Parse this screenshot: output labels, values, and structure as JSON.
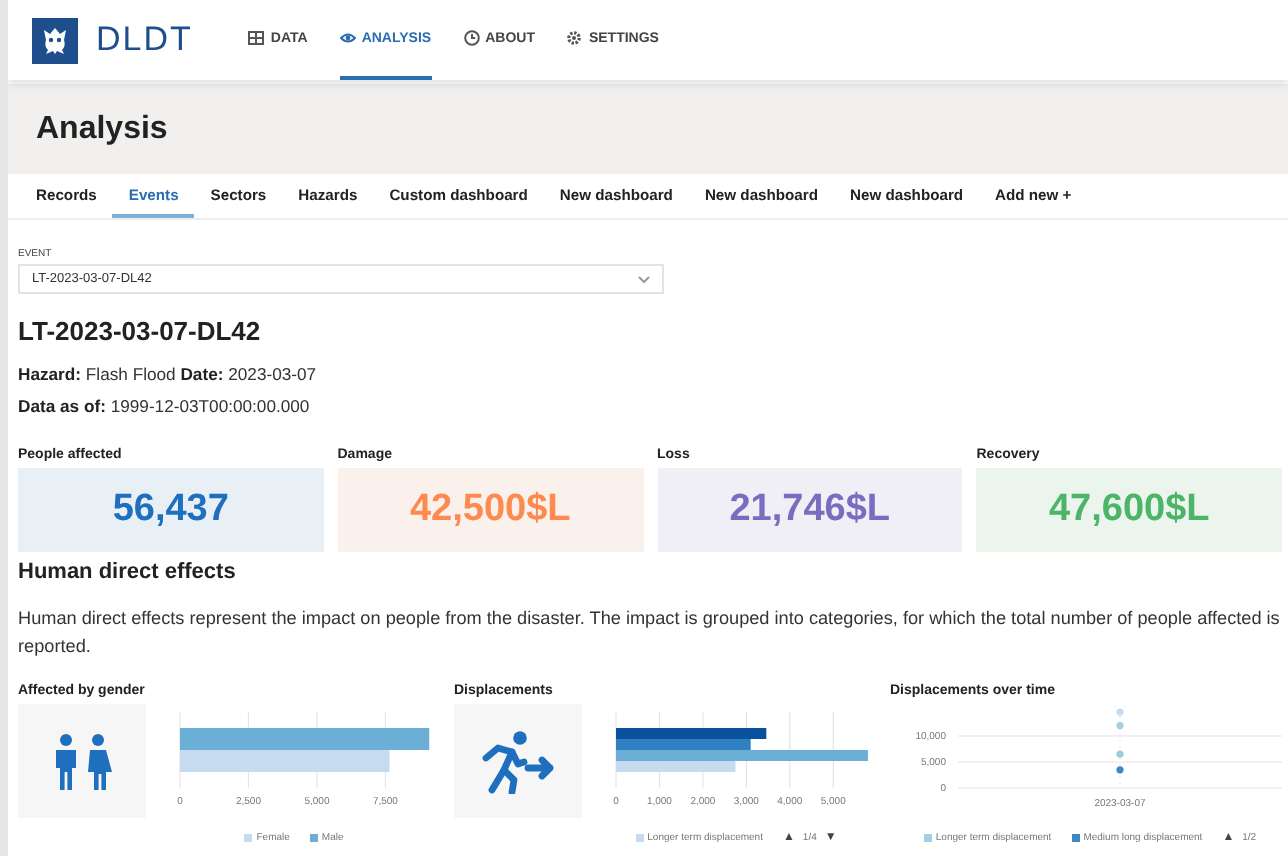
{
  "header": {
    "brand": "DLDT",
    "nav": [
      {
        "label": "DATA",
        "selected": false
      },
      {
        "label": "ANALYSIS",
        "selected": true
      },
      {
        "label": "ABOUT",
        "selected": false
      },
      {
        "label": "SETTINGS",
        "selected": false
      }
    ]
  },
  "page_title": "Analysis",
  "tabs": [
    {
      "label": "Records",
      "selected": false
    },
    {
      "label": "Events",
      "selected": true
    },
    {
      "label": "Sectors",
      "selected": false
    },
    {
      "label": "Hazards",
      "selected": false
    },
    {
      "label": "Custom dashboard",
      "selected": false
    },
    {
      "label": "New dashboard",
      "selected": false
    },
    {
      "label": "New dashboard",
      "selected": false
    },
    {
      "label": "New dashboard",
      "selected": false
    },
    {
      "label": "Add new +",
      "selected": false
    }
  ],
  "event": {
    "label": "EVENT",
    "value": "LT-2023-03-07-DL42",
    "heading": "LT-2023-03-07-DL42",
    "hazard_line": "**Hazard:** Flash Flood **Date:** 2023-03-07",
    "data_line": "**Data as of:** 1999-12-03T00:00:00.000"
  },
  "stats": [
    {
      "label": "People affected",
      "value": "56,437",
      "color": "#1f6fbf"
    },
    {
      "label": "Damage",
      "value": "42,500$L",
      "color": "#fd8a4f"
    },
    {
      "label": "Loss",
      "value": "21,746$L",
      "color": "#7a6cc0"
    },
    {
      "label": "Recovery",
      "value": "47,600$L",
      "color": "#4cb56a"
    }
  ],
  "human_effects": {
    "title": "Human direct effects",
    "description": "Human direct effects represent the impact on people from the disaster. The impact is grouped into categories, for which the total number of people affected is reported."
  },
  "charts": [
    {
      "title": "Affected by gender",
      "chart_data": {
        "type": "bar",
        "orientation": "horizontal",
        "grid": true,
        "xlim": [
          0,
          9200
        ],
        "xticks": [
          {
            "value": 0,
            "label": "0"
          },
          {
            "value": 2500,
            "label": "2,500"
          },
          {
            "value": 5000,
            "label": "5,000"
          },
          {
            "value": 7500,
            "label": "7,500"
          }
        ],
        "series": [
          {
            "name": "Female",
            "color": "#c6dbef",
            "values": [
              7650
            ]
          },
          {
            "name": "Male",
            "color": "#6baed6",
            "values": [
              9100
            ]
          }
        ]
      }
    },
    {
      "title": "Displacements",
      "legend_nav": {
        "prev": "▲",
        "page": "1/4",
        "next": "▼"
      },
      "chart_data": {
        "type": "bar",
        "orientation": "horizontal",
        "grid": true,
        "xlim": [
          0,
          5800
        ],
        "xticks": [
          {
            "value": 0,
            "label": "0"
          },
          {
            "value": 1000,
            "label": "1,000"
          },
          {
            "value": 2000,
            "label": "2,000"
          },
          {
            "value": 3000,
            "label": "3,000"
          },
          {
            "value": 4000,
            "label": "4,000"
          },
          {
            "value": 5000,
            "label": "5,000"
          }
        ],
        "series": [
          {
            "name": "Longer term displacement",
            "color": "#c6dbef",
            "values": [
              2750
            ]
          },
          {
            "color": "#6baed6",
            "values": [
              5800
            ]
          },
          {
            "color": "#2f7fc1",
            "values": [
              3100
            ]
          },
          {
            "color": "#08519c",
            "values": [
              3460
            ]
          }
        ]
      }
    },
    {
      "title": "Displacements over time",
      "legend_nav": {
        "prev": "▲",
        "page": "1/2"
      },
      "chart_data": {
        "type": "scatter",
        "x": [
          "2023-03-07"
        ],
        "grid": true,
        "ylim": [
          0,
          15000
        ],
        "yticks": [
          {
            "value": 0,
            "label": "0"
          },
          {
            "value": 5000,
            "label": "5,000"
          },
          {
            "value": 10000,
            "label": "10,000"
          }
        ],
        "series": [
          {
            "name": "Longer term displacement",
            "color": "#a6cee3",
            "values": [
              12000
            ]
          },
          {
            "name": "Medium long displacement",
            "color": "#3f88c5",
            "values": [
              3500
            ]
          },
          {
            "color": "#c6dbef",
            "values": [
              14600
            ]
          },
          {
            "color": "#9ecae1",
            "values": [
              6500
            ]
          }
        ]
      }
    }
  ]
}
